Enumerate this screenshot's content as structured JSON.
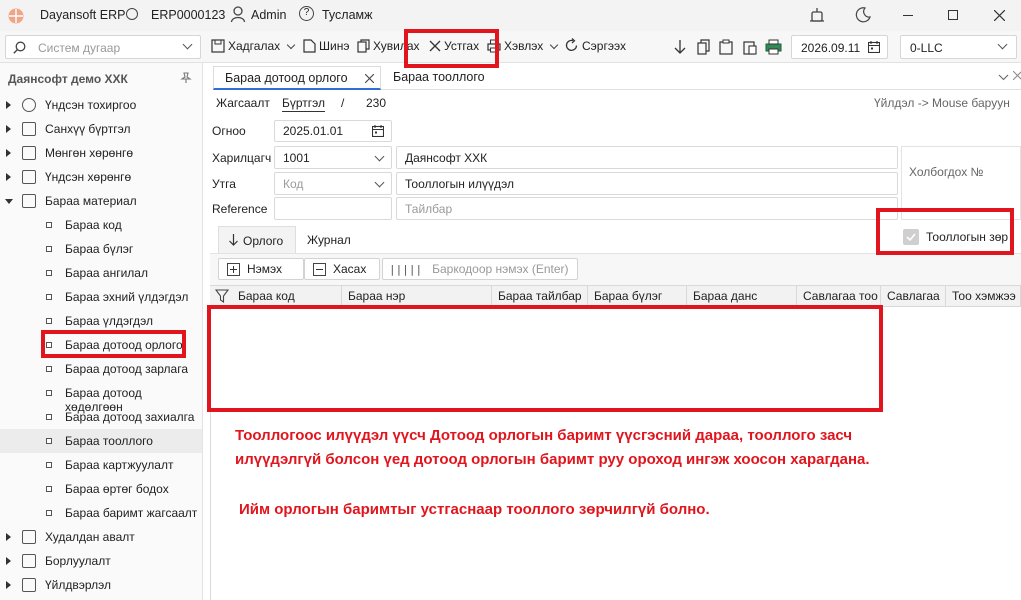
{
  "titlebar": {
    "app_name": "Dayansoft ERP",
    "db_name": "ERP0000123",
    "user": "Admin",
    "help": "Тусламж"
  },
  "toolbar": {
    "search_placeholder": "Систем дугаар",
    "add": "Хадгалах",
    "new": "Шинэ",
    "copy": "Хувилах",
    "delete": "Устгах",
    "print": "Хэвлэх",
    "refresh": "Сэргээх",
    "date": "2026.09.11",
    "company": "0-LLC"
  },
  "sidebar": {
    "company": "Даянсофт демо ХХК",
    "items": [
      {
        "label": "Үндсэн тохиргоо",
        "level": 0
      },
      {
        "label": "Санхүү бүртгэл",
        "level": 0
      },
      {
        "label": "Мөнгөн хөрөнгө",
        "level": 0
      },
      {
        "label": "Үндсэн хөрөнгө",
        "level": 0
      },
      {
        "label": "Бараа материал",
        "level": 0,
        "expanded": true
      },
      {
        "label": "Бараа код",
        "level": 1
      },
      {
        "label": "Бараа бүлэг",
        "level": 1
      },
      {
        "label": "Бараа ангилал",
        "level": 1
      },
      {
        "label": "Бараа эхний үлдэгдэл",
        "level": 1
      },
      {
        "label": "Бараа үлдэгдэл",
        "level": 1
      },
      {
        "label": "Бараа дотоод орлого",
        "level": 1
      },
      {
        "label": "Бараа дотоод зарлага",
        "level": 1
      },
      {
        "label": "Бараа дотоод хөдөлгөөн",
        "level": 1
      },
      {
        "label": "Бараа дотоод захиалга",
        "level": 1
      },
      {
        "label": "Бараа тооллого",
        "level": 1,
        "selected": true
      },
      {
        "label": "Бараа картжуулалт",
        "level": 1
      },
      {
        "label": "Бараа өртөг бодох",
        "level": 1
      },
      {
        "label": "Бараа баримт жагсаалт",
        "level": 1
      },
      {
        "label": "Худалдан авалт",
        "level": 0
      },
      {
        "label": "Борлуулалт",
        "level": 0
      },
      {
        "label": "Үйлдвэрлэл",
        "level": 0
      }
    ]
  },
  "tabs": [
    {
      "label": "Бараа дотоод орлого",
      "active": true
    },
    {
      "label": "Бараа тооллого",
      "active": false
    }
  ],
  "breadcrumb": {
    "list": "Жагсаалт",
    "register": "Бүртгэл",
    "sep": "/",
    "count": "230",
    "hint": "Үйлдэл -> Mouse баруун"
  },
  "form": {
    "date_label": "Огноо",
    "date_value": "2025.01.01",
    "partner_label": "Харилцагч",
    "partner_code": "1001",
    "partner_name": "Даянсофт ХХК",
    "purpose_label": "Утга",
    "purpose_placeholder": "Код",
    "purpose_text": "Тооллогын илүүдэл",
    "reference_label": "Reference",
    "note_placeholder": "Тайлбар",
    "related_label": "Холбогдох №",
    "inventory_check_label": "Тооллогын зөр"
  },
  "subtabs": [
    "Орлого",
    "Журнал"
  ],
  "grid_toolbar": {
    "add": "Нэмэх",
    "remove": "Хасах",
    "barcode_placeholder": "Баркодоор нэмэх (Enter)"
  },
  "grid_columns": [
    "Бараа код",
    "Бараа нэр",
    "Бараа тайлбар",
    "Бараа бүлэг",
    "Бараа данс",
    "Савлагаа тоо",
    "Савлагаа",
    "Тоо хэмжээ"
  ],
  "annotation": {
    "line1": "Тооллогоос илүүдэл үүсч Дотоод орлогын баримт үүсгэсний дараа, тооллого засч",
    "line2": "илүүдэлгүй болсон үед дотоод орлогын баримт руу ороход ингэж хоосон харагдана.",
    "line3": "Ийм орлогын баримтыг устгаснаар тооллого зөрчилгүй болно."
  },
  "colors": {
    "accent": "#e0151d"
  }
}
